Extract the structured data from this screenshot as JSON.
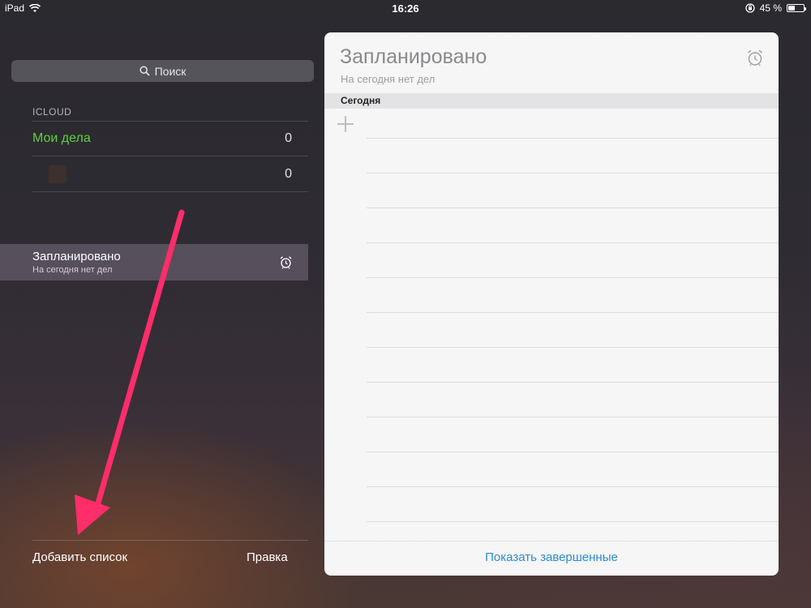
{
  "status_bar": {
    "device": "iPad",
    "time": "16:26",
    "battery_text": "45 %",
    "battery_level": 0.45
  },
  "sidebar": {
    "search_label": "Поиск",
    "section_header": "ICLOUD",
    "lists": [
      {
        "name": "Мои дела",
        "count": "0",
        "color": "#5fd13f"
      },
      {
        "name": "",
        "count": "0",
        "color": "#3d302d"
      }
    ],
    "scheduled": {
      "title": "Запланировано",
      "subtitle": "На сегодня нет дел"
    },
    "add_list_label": "Добавить список",
    "edit_label": "Правка"
  },
  "main": {
    "title": "Запланировано",
    "subtitle": "На сегодня нет дел",
    "section_label": "Сегодня",
    "show_completed_label": "Показать завершенные"
  },
  "colors": {
    "accent_blue": "#2a8bd8",
    "annotation_arrow": "#ff2d6a"
  },
  "icons": {
    "search": "search-icon",
    "alarm": "alarm-clock-icon",
    "add": "plus-icon",
    "wifi": "wifi-icon",
    "battery": "battery-icon"
  }
}
